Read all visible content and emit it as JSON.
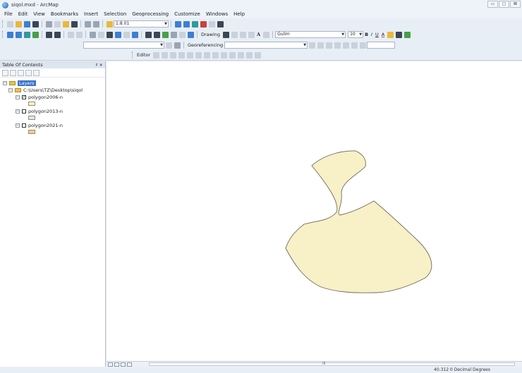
{
  "window": {
    "title": "siqol.mxd - ArcMap",
    "minimize": "▭",
    "maximize": "▢",
    "close": "⊠"
  },
  "menu": [
    "File",
    "Edit",
    "View",
    "Bookmarks",
    "Insert",
    "Selection",
    "Geoprocessing",
    "Customize",
    "Windows",
    "Help"
  ],
  "toolbar": {
    "scale_value": "1:8.01",
    "drawing_label": "Drawing",
    "font_name": "Gulim",
    "font_size": "10",
    "bold": "B",
    "italic": "I",
    "underline": "U",
    "font_color_glyph": "A",
    "text_glyph": "A",
    "georeferencing_label": "Georeferencing",
    "editor_label": "Editor"
  },
  "toc": {
    "title": "Table Of Contents",
    "pin": "♯ ×",
    "layers_label": "Layers",
    "folder_path": "C:\\Users\\TZ\\Desktop\\siqol",
    "items": [
      {
        "name": "polygon2006-n",
        "checked": true,
        "swatch": "#fbf2c9"
      },
      {
        "name": "polygon2013-n",
        "checked": false,
        "swatch": "#cfeef3"
      },
      {
        "name": "polygon2021-n",
        "checked": false,
        "swatch": "#f3cd8f"
      }
    ]
  },
  "map": {
    "polygon_fill": "#f8f0c6",
    "polygon_stroke": "#6f6a5a"
  },
  "status": {
    "coords": "40.312  0 Decimal Degrees",
    "scroll_mark": "III"
  },
  "colors": {
    "accent": "#3a74c9",
    "background": "#dfe6ef"
  }
}
